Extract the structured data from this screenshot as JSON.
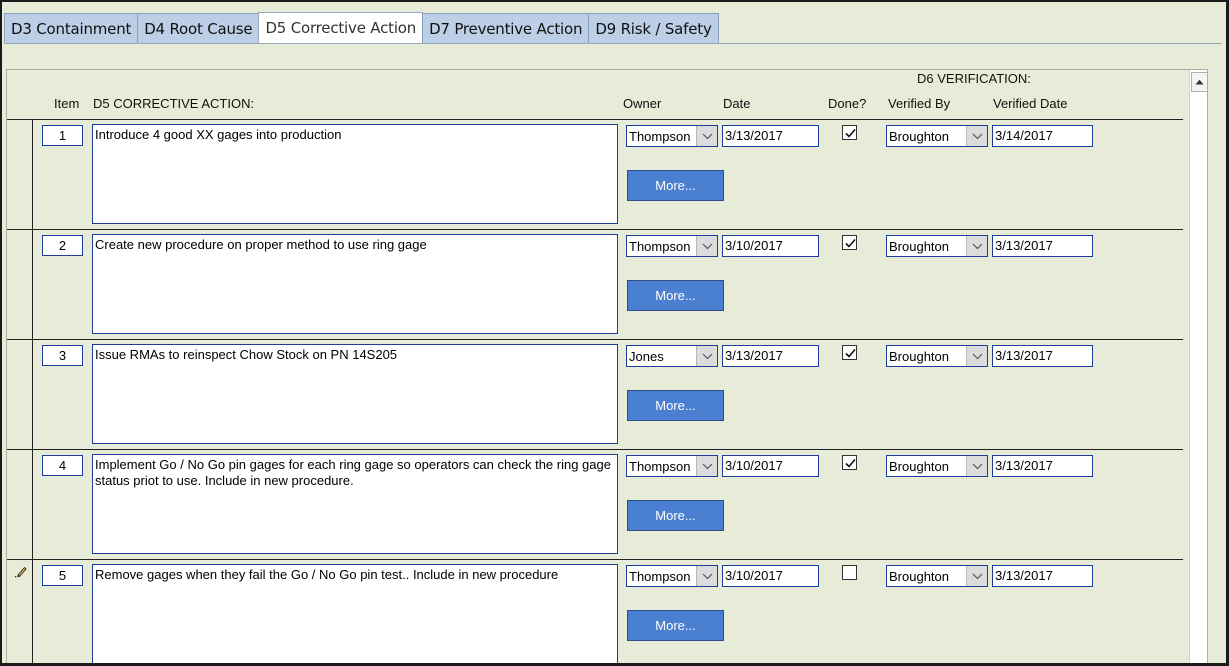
{
  "tabs": [
    {
      "label": "D3 Containment"
    },
    {
      "label": "D4 Root Cause"
    },
    {
      "label": "D5 Corrective Action",
      "active": true
    },
    {
      "label": "D7 Preventive Action"
    },
    {
      "label": "D9 Risk / Safety"
    }
  ],
  "headers": {
    "verification_group": "D6  VERIFICATION:",
    "item": "Item",
    "corrective_action": "D5  CORRECTIVE ACTION:",
    "owner": "Owner",
    "date": "Date",
    "done": "Done?",
    "verified_by": "Verified By",
    "verified_date": "Verified Date"
  },
  "more_label": "More...",
  "rows": [
    {
      "item": "1",
      "action": "Introduce 4 good XX gages into production",
      "owner": "Thompson",
      "date": "3/13/2017",
      "done": true,
      "verified_by": "Broughton",
      "verified_date": "3/14/2017"
    },
    {
      "item": "2",
      "action": "Create new procedure on proper method to use ring gage",
      "owner": "Thompson",
      "date": "3/10/2017",
      "done": true,
      "verified_by": "Broughton",
      "verified_date": "3/13/2017"
    },
    {
      "item": "3",
      "action": "Issue RMAs to reinspect Chow Stock on PN 14S205",
      "owner": "Jones",
      "date": "3/13/2017",
      "done": true,
      "verified_by": "Broughton",
      "verified_date": "3/13/2017"
    },
    {
      "item": "4",
      "action": "Implement Go / No Go pin gages for each ring gage so operators can check the ring gage status priot to use. Include in new procedure.",
      "owner": "Thompson",
      "date": "3/10/2017",
      "done": true,
      "verified_by": "Broughton",
      "verified_date": "3/13/2017"
    },
    {
      "item": "5",
      "action": "Remove gages when they fail the Go / No Go pin test.. Include in new procedure",
      "owner": "Thompson",
      "date": "3/10/2017",
      "done": false,
      "verified_by": "Broughton",
      "verified_date": "3/13/2017",
      "editing": true
    }
  ],
  "icons": {
    "dropdown": "chevron-down-icon",
    "checkmark": "checkmark-icon",
    "edit_record": "pencil-icon",
    "scroll_up": "triangle-up-icon"
  },
  "colors": {
    "panel_background": "#e6ecd8",
    "tab_inactive": "#bccfe6",
    "field_border": "#1c3c9c",
    "more_button": "#4a7fd1"
  }
}
